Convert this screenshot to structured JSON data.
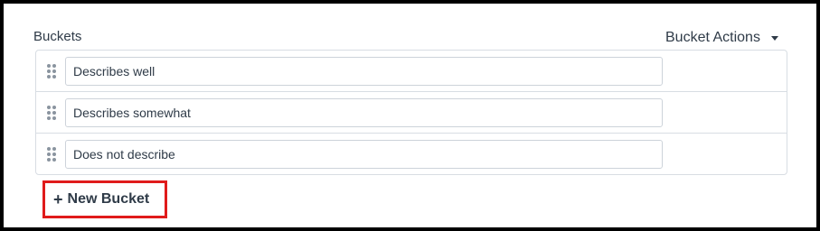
{
  "section_title": "Buckets",
  "actions_label": "Bucket Actions",
  "buckets": [
    {
      "value": "Describes well"
    },
    {
      "value": "Describes somewhat"
    },
    {
      "value": "Does not describe"
    }
  ],
  "new_bucket_label": "New Bucket",
  "icons": {
    "drag": "drag-handle-icon",
    "caret": "caret-down-icon",
    "plus": "plus-icon"
  },
  "colors": {
    "text": "#2f3b48",
    "border": "#d8dde3",
    "highlight": "#e01b1b"
  }
}
